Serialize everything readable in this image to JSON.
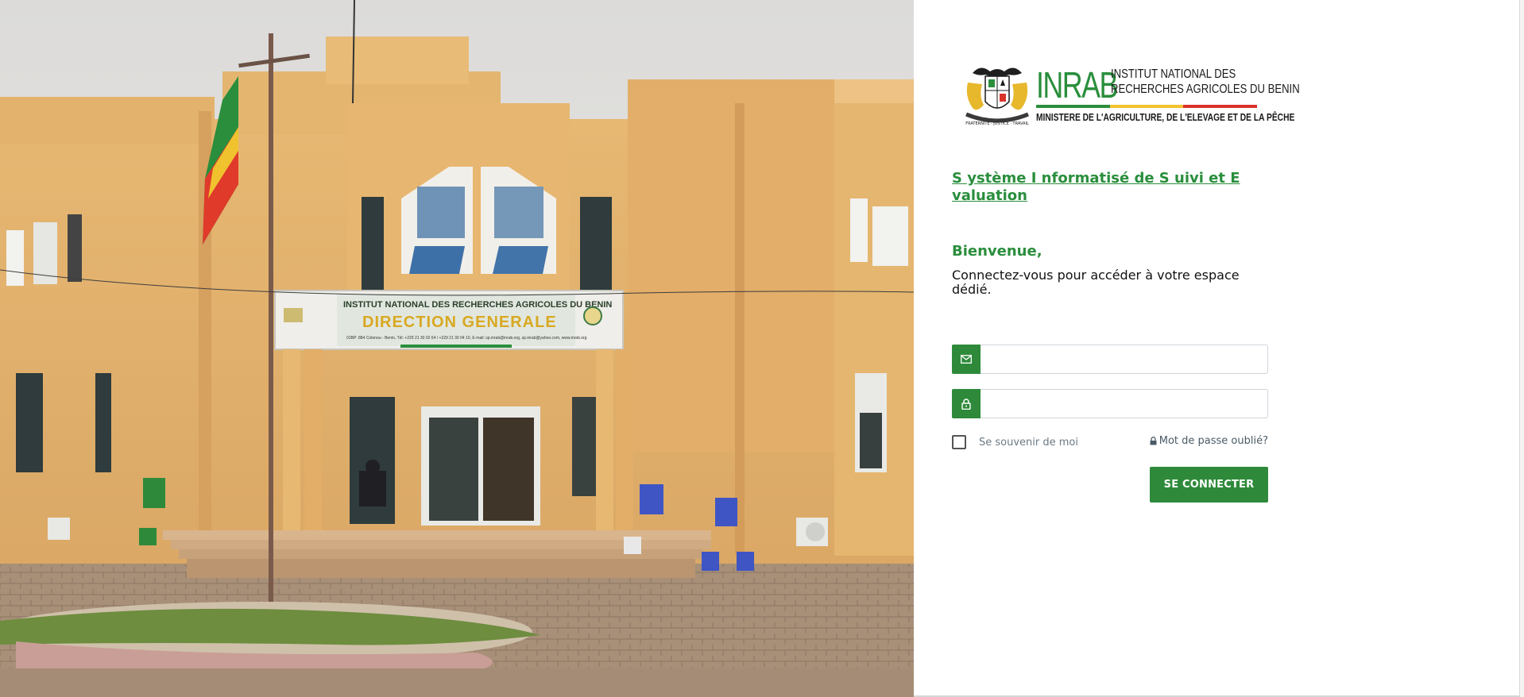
{
  "photo": {
    "alt": "Bâtiment de la Direction Générale de l'INRAB",
    "sign_line1": "INSTITUT NATIONAL DES RECHERCHES AGRICOLES DU BENIN",
    "sign_line2": "DIRECTION GENERALE",
    "sign_line3": "01BP: 884 Cotonou - Benin, Tél: +229 21 30 02 64 / +229 21 30 04 10, E-mail: sp.inrab@inrab.org, sp.inrab@yahoo.com, www.inrab.org"
  },
  "logo": {
    "abbr": "INRAB",
    "name_line1": "INSTITUT NATIONAL DES",
    "name_line2": "RECHERCHES AGRICOLES DU BENIN",
    "ministry": "MINISTERE DE L'AGRICULTURE, DE L'ELEVAGE  ET DE LA PÊCHE",
    "coat_icon": "benin-coat-of-arms-icon",
    "flag_colors": [
      "#2a8e3c",
      "#f2c230",
      "#d9322b"
    ]
  },
  "app_title": "S ystème I nformatisé de S uivi et E valuation",
  "welcome": "Bienvenue,",
  "subtext": "Connectez-vous pour accéder à votre espace dédié.",
  "form": {
    "username_value": "",
    "username_icon": "envelope-icon",
    "password_value": "",
    "password_icon": "lock-icon",
    "remember_label": "Se souvenir de moi",
    "forgot_label": "Mot de passe oublié?",
    "submit_label": "SE CONNECTER"
  },
  "colors": {
    "accent": "#2e8a3a",
    "title_green": "#2a8e3c"
  }
}
